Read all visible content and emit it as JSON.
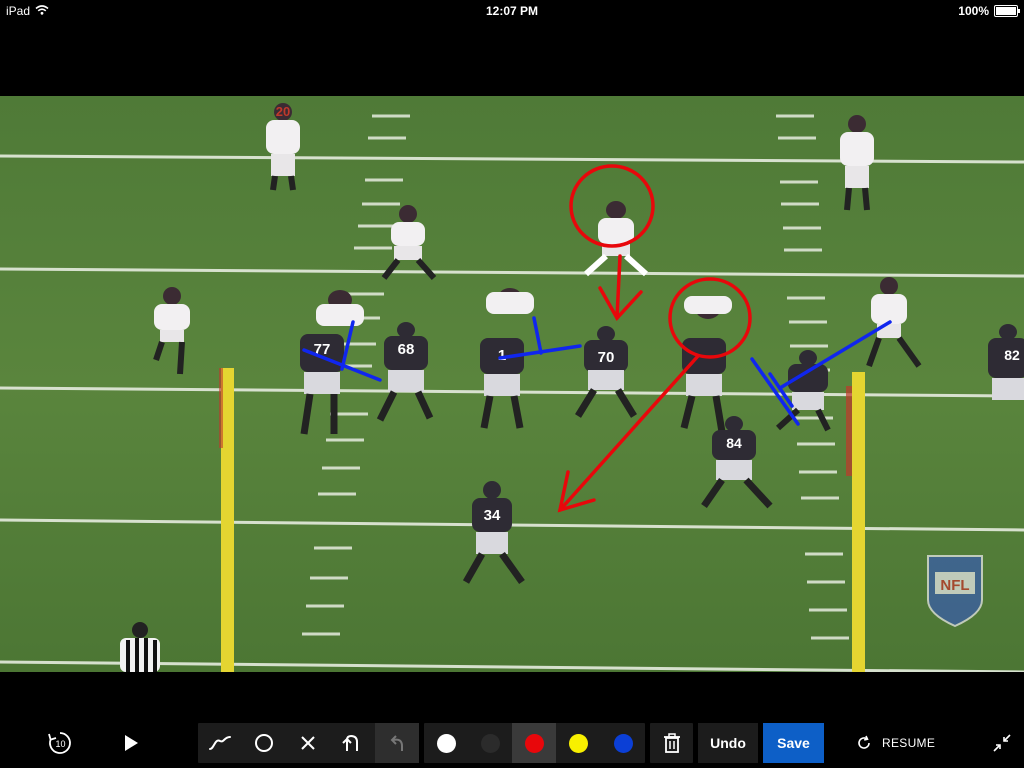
{
  "status_bar": {
    "device": "iPad",
    "time": "12:07 PM",
    "battery": "100%"
  },
  "video": {
    "watermark": "NFL",
    "jersey_numbers": [
      "20",
      "77",
      "68",
      "1",
      "70",
      "84",
      "34",
      "82"
    ]
  },
  "toolbar": {
    "rewind_label": "10",
    "tools": [
      {
        "icon": "freehand-line-icon",
        "name": "tool-freehand"
      },
      {
        "icon": "circle-icon",
        "name": "tool-circle"
      },
      {
        "icon": "x-mark-icon",
        "name": "tool-x"
      },
      {
        "icon": "arrow-icon",
        "name": "tool-arrow"
      },
      {
        "icon": "undo-arrow-icon",
        "name": "tool-undo-arrow",
        "disabled": true
      }
    ],
    "colors": [
      {
        "name": "white",
        "hex": "#ffffff"
      },
      {
        "name": "black",
        "hex": "#2b2b2b"
      },
      {
        "name": "red",
        "hex": "#e8070b",
        "selected": true
      },
      {
        "name": "yellow",
        "hex": "#f8f000"
      },
      {
        "name": "blue",
        "hex": "#0b3fd6"
      }
    ],
    "undo_label": "Undo",
    "save_label": "Save",
    "resume_label": "RESUME"
  },
  "annotation_colors": {
    "red": "#e8070b",
    "blue": "#1026ee"
  }
}
